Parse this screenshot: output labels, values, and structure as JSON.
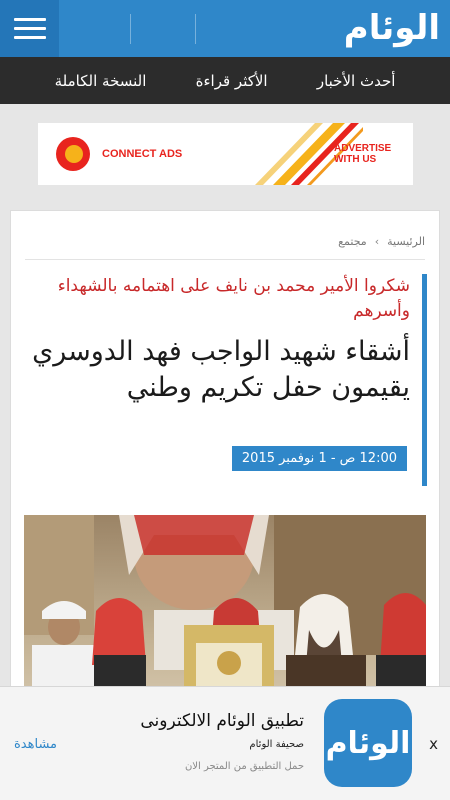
{
  "header": {
    "logo_text": "الوئام",
    "brand_color": "#2f87c9"
  },
  "nav": {
    "items": [
      {
        "label": "أحدث الأخبار"
      },
      {
        "label": "الأكثر قراءة"
      },
      {
        "label": "النسخة الكاملة"
      }
    ]
  },
  "ad": {
    "brand": "CONNECT ADS",
    "cta_line1": "ADVERTISE",
    "cta_line2": "WITH US"
  },
  "breadcrumb": {
    "home": "الرئيسية",
    "separator": "›",
    "section": "مجتمع"
  },
  "article": {
    "kicker": "شكروا الأمير محمد بن نايف على اهتمامه بالشهداء وأسرهم",
    "title": "أشقاء شهيد الواجب فهد الدوسري يقيمون حفل تكريم وطني",
    "date": "12:00 ص - 1 نوفمبر 2015",
    "kicker_color": "#c8292a"
  },
  "app_banner": {
    "close": "x",
    "icon_text": "الوئام",
    "title": "تطبيق الوئام الالكترونى",
    "subtitle": "صحيفة الوئام",
    "note": "حمل التطبيق من المتجر الان",
    "view": "مشاهدة"
  }
}
